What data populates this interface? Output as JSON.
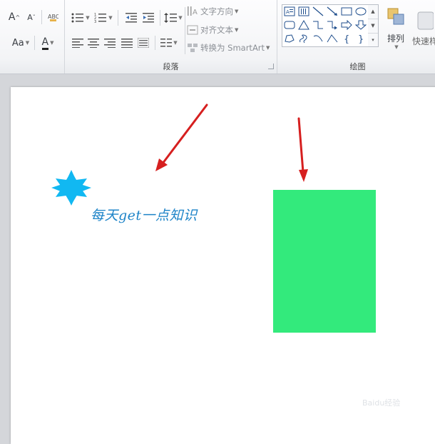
{
  "ribbon": {
    "font_group": {
      "grow_font": "A",
      "shrink_font": "A",
      "change_case": "Aa",
      "font_color": "A"
    },
    "paragraph_group": {
      "label": "段落",
      "text_direction": "文字方向",
      "align_text": "对齐文本",
      "convert_smartart": "转换为 SmartArt"
    },
    "drawing_group": {
      "label": "绘图",
      "arrange": "排列",
      "quick_styles": "快速样"
    }
  },
  "slide": {
    "caption": "每天get一点知识",
    "star_color": "#11b8f2",
    "rect_color": "#33ea7c",
    "arrow_color": "#d61f1f"
  },
  "watermark": "Baidu经验"
}
